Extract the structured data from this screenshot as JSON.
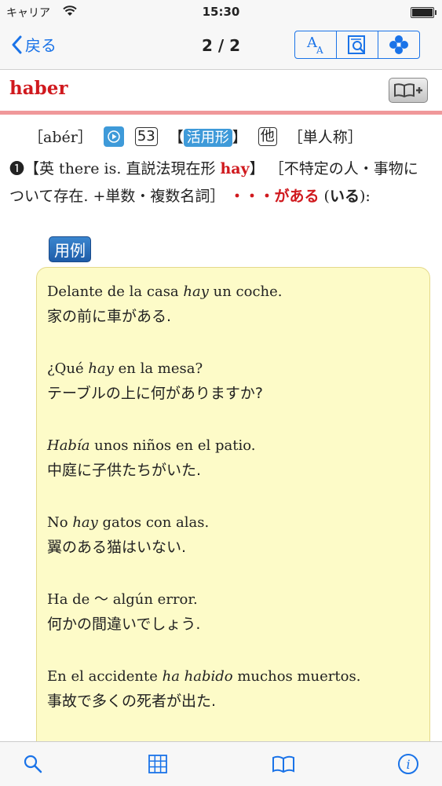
{
  "status": {
    "carrier": "キャリア",
    "time": "15:30",
    "battery": 1.0
  },
  "nav": {
    "back_label": "戻る",
    "title": "2 / 2",
    "buttons": [
      "font-size-icon",
      "search-document-icon",
      "flower-icon"
    ]
  },
  "entry": {
    "headword": "haber",
    "pronunciation": "［abér］",
    "conj_num": "53",
    "conj_label_open": "【",
    "conj_label": "活用形",
    "conj_label_close": "】",
    "tatsu": "他",
    "singular": "［単人称］",
    "sense_num": "❶",
    "sense_parts": {
      "p1": "【英 there is. 直説法現在形 ",
      "hay": "hay",
      "p2": "】 ［不特定の人・事物について存在. +単数・複数名詞］ ",
      "red": "・・・がある",
      "p3": " (",
      "bold": "いる",
      "p4": "):"
    },
    "yorei": "用例"
  },
  "examples": [
    {
      "es_pre": "Delante de la casa ",
      "es_it": "hay",
      "es_post": " un coche.",
      "ja": "家の前に車がある."
    },
    {
      "es_pre": "¿Qué ",
      "es_it": "hay",
      "es_post": " en la mesa?",
      "ja": "テーブルの上に何がありますか?"
    },
    {
      "es_pre": "",
      "es_it": "Había",
      "es_post": " unos niños en el patio.",
      "ja": "中庭に子供たちがいた."
    },
    {
      "es_pre": "No ",
      "es_it": "hay",
      "es_post": " gatos con alas.",
      "ja": "翼のある猫はいない."
    },
    {
      "es_pre": "Ha de 〜 algún error.",
      "es_it": "",
      "es_post": "",
      "ja": "何かの間違いでしょう."
    },
    {
      "es_pre": "En el accidente ",
      "es_it": "ha habido",
      "es_post": " muchos muertos.",
      "ja": "事故で多くの死者が出た."
    }
  ],
  "tabs": [
    "search-icon",
    "grid-icon",
    "book-icon",
    "info-icon"
  ],
  "colors": {
    "accent": "#1a73e8",
    "headword": "#d0191e",
    "rule": "#f0989a",
    "example_bg": "#fdfbc8"
  }
}
